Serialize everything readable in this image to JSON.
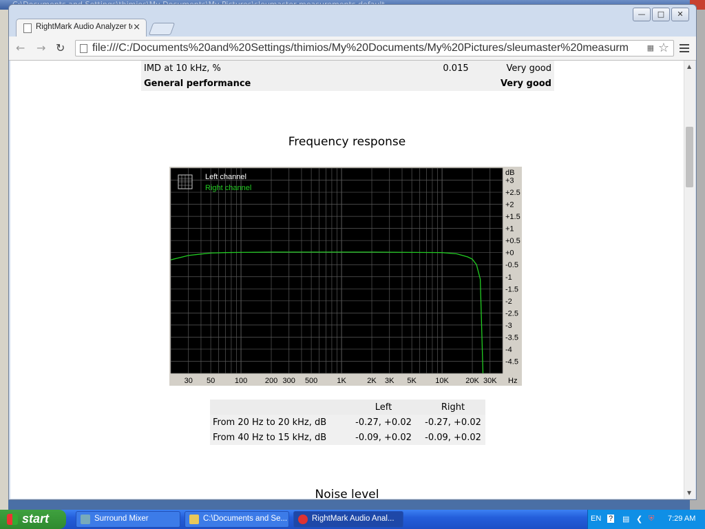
{
  "background": {
    "top_title": "C:\\Documents and Settings\\thimios\\My Documents\\My Pictures\\sleumaster measurements default.."
  },
  "window": {
    "caption_buttons": [
      "minimize",
      "maximize",
      "close"
    ],
    "tab_title": "RightMark Audio Analyzer te",
    "url": "file:///C:/Documents%20and%20Settings/thimios/My%20Documents/My%20Pictures/sleumaster%20measurm"
  },
  "summary_table": {
    "rows": [
      {
        "name": "IMD at 10 kHz, %",
        "value": "0.015",
        "rating": "Very good"
      },
      {
        "name": "General performance",
        "value": "",
        "rating": "Very good"
      }
    ]
  },
  "section_title": "Frequency response",
  "chart_data": {
    "type": "line",
    "title": "",
    "xlabel": "Hz",
    "ylabel": "dB",
    "xscale": "log",
    "xlim": [
      20,
      40000
    ],
    "ylim": [
      -5,
      3.5
    ],
    "x_tick_labels": [
      "30",
      "50",
      "100",
      "200",
      "300",
      "500",
      "1K",
      "2K",
      "3K",
      "5K",
      "10K",
      "20K",
      "30K"
    ],
    "y_tick_labels": [
      "+3",
      "+2.5",
      "+2",
      "+1.5",
      "+1",
      "+0.5",
      "+0",
      "-0.5",
      "-1",
      "-1.5",
      "-2",
      "-2.5",
      "-3",
      "-3.5",
      "-4",
      "-4.5"
    ],
    "grid": true,
    "legend": {
      "entries": [
        "Left channel",
        "Right channel"
      ],
      "position": "top-left"
    },
    "colors": {
      "background": "#000000",
      "left": "#ffffff",
      "right": "#22cc22",
      "grid": "#5a5a5a"
    },
    "series": [
      {
        "name": "Right channel",
        "x": [
          20,
          25,
          30,
          40,
          50,
          70,
          100,
          200,
          500,
          1000,
          2000,
          5000,
          10000,
          14000,
          18000,
          20000,
          22000,
          24000,
          25500
        ],
        "y": [
          -0.3,
          -0.2,
          -0.12,
          -0.06,
          -0.02,
          0.0,
          0.01,
          0.02,
          0.02,
          0.02,
          0.02,
          0.01,
          0.0,
          -0.05,
          -0.18,
          -0.27,
          -0.5,
          -1.1,
          -5.0
        ]
      }
    ]
  },
  "response_table": {
    "headers": [
      "",
      "Left",
      "Right"
    ],
    "rows": [
      [
        "From 20 Hz to 20 kHz, dB",
        "-0.27, +0.02",
        "-0.27, +0.02"
      ],
      [
        "From 40 Hz to 15 kHz, dB",
        "-0.09, +0.02",
        "-0.09, +0.02"
      ]
    ]
  },
  "next_section_title": "Noise level",
  "taskbar": {
    "start_label": "start",
    "tasks": [
      {
        "label": "Surround Mixer"
      },
      {
        "label": "C:\\Documents and Se..."
      },
      {
        "label": "RightMark Audio Anal..."
      }
    ],
    "tray": {
      "language": "EN",
      "time": "7:29 AM"
    }
  }
}
